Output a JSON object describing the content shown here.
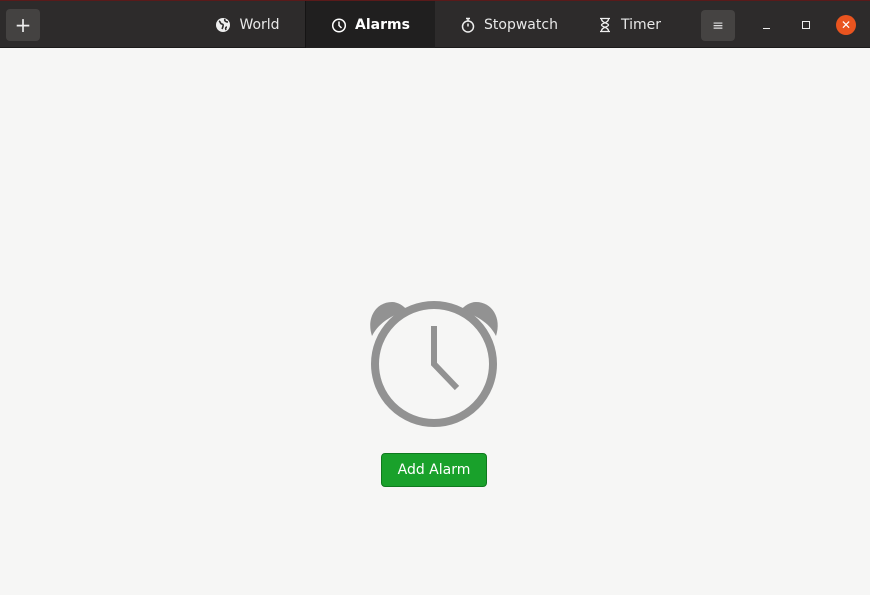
{
  "header": {
    "new_label": "+",
    "tabs": [
      {
        "label": "World",
        "icon": "globe-icon"
      },
      {
        "label": "Alarms",
        "icon": "clock-icon",
        "active": true
      },
      {
        "label": "Stopwatch",
        "icon": "stopwatch-icon"
      },
      {
        "label": "Timer",
        "icon": "hourglass-icon"
      }
    ],
    "menu_icon": "hamburger-menu-icon",
    "close_color": "#e9541f"
  },
  "main": {
    "empty_icon": "alarm-clock-icon",
    "add_alarm_label": "Add Alarm",
    "accent": "#19a12b"
  }
}
